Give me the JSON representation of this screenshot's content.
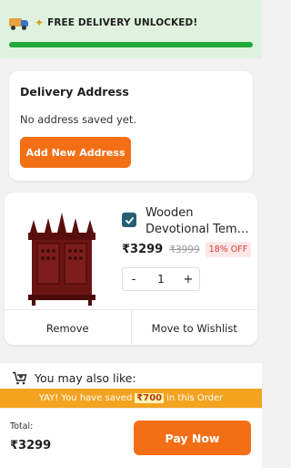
{
  "banner": {
    "text": "FREE DELIVERY UNLOCKED!",
    "progress": 1.0,
    "icons": [
      "delivery-truck-icon",
      "party-popper-icon"
    ]
  },
  "address": {
    "title": "Delivery Address",
    "empty_text": "No address saved yet.",
    "add_button": "Add New Address"
  },
  "cart_item": {
    "title_line1": "Wooden",
    "title_line2": "Devotional Temple",
    "selected": true,
    "price": "₹3299",
    "mrp": "₹3999",
    "discount": "18% OFF",
    "qty_minus": "-",
    "quantity": "1",
    "qty_plus": "+",
    "remove_label": "Remove",
    "wishlist_label": "Move to Wishlist"
  },
  "recommendations": {
    "heading": "You may also like:"
  },
  "savings": {
    "prefix": "YAY! You have saved",
    "amount": "₹700",
    "suffix": "in this Order"
  },
  "footer": {
    "total_label": "Total:",
    "total_value": "₹3299",
    "pay_button": "Pay Now"
  },
  "colors": {
    "accent": "#f36f16",
    "progress": "#1faa3a",
    "checkbox": "#245f73",
    "savings_bar": "#f4a320"
  }
}
